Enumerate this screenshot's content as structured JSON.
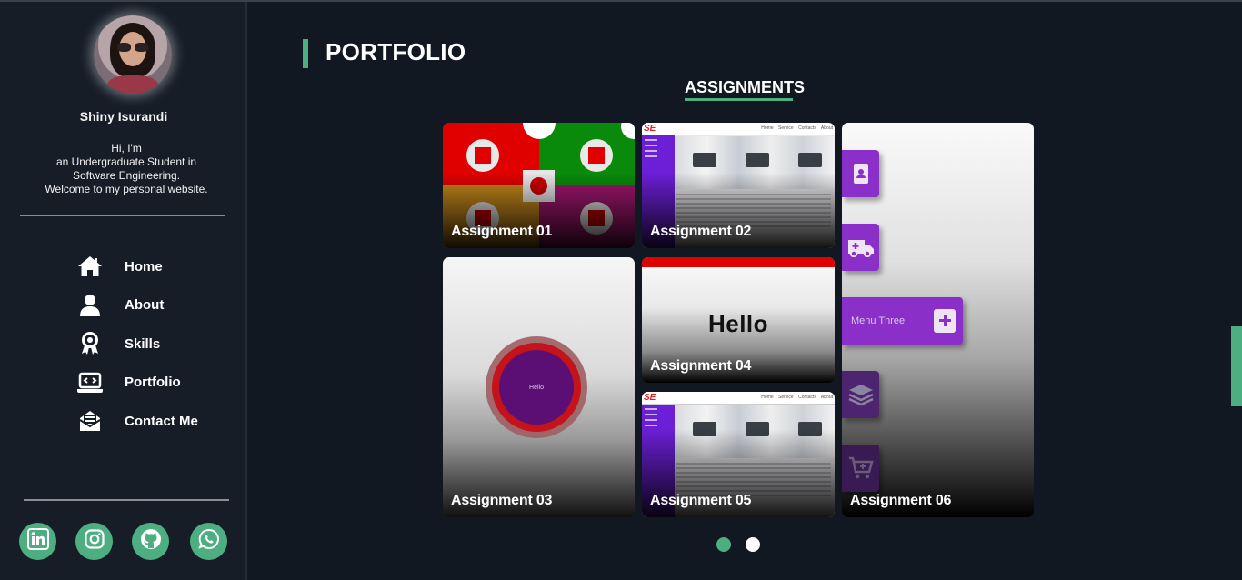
{
  "profile": {
    "name": "Shiny Isurandi",
    "intro_lines": [
      "Hi, I'm",
      "an Undergraduate Student in",
      "Software Engineering.",
      "Welcome to my personal website."
    ]
  },
  "nav": [
    {
      "label": "Home",
      "icon": "home-icon"
    },
    {
      "label": "About",
      "icon": "user-icon"
    },
    {
      "label": "Skills",
      "icon": "award-icon"
    },
    {
      "label": "Portfolio",
      "icon": "laptop-code-icon"
    },
    {
      "label": "Contact Me",
      "icon": "mail-icon"
    }
  ],
  "socials": [
    "linkedin-icon",
    "instagram-icon",
    "github-icon",
    "whatsapp-icon"
  ],
  "portfolio": {
    "title": "PORTFOLIO",
    "section": "ASSIGNMENTS",
    "cards": [
      {
        "label": "Assignment 01"
      },
      {
        "label": "Assignment 02"
      },
      {
        "label": "Assignment 03",
        "inner_text": "Hello"
      },
      {
        "label": "Assignment 04",
        "inner_text": "Hello"
      },
      {
        "label": "Assignment 05"
      },
      {
        "label": "Assignment 06",
        "menu_text": "Menu Three"
      }
    ],
    "pages": 2,
    "active_page": 1
  },
  "colors": {
    "accent": "#4dae81",
    "background": "#121821",
    "sidebar": "#161d27",
    "purple": "#8a2fc7"
  }
}
